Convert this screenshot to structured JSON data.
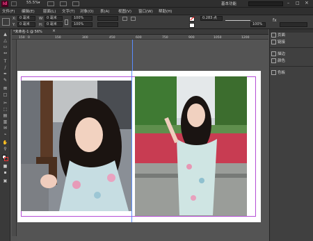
{
  "app": {
    "logo": "Id",
    "zoom": "55.5%",
    "workspace": "基本功能"
  },
  "menu": [
    "文件(F)",
    "编辑(E)",
    "版面(L)",
    "文字(T)",
    "对象(O)",
    "表(A)",
    "视图(V)",
    "窗口(W)",
    "帮助(H)"
  ],
  "control": {
    "x": "0 毫米",
    "y": "0 毫米",
    "w": "0 毫米",
    "h": "0 毫米",
    "stroke": "0.283 点",
    "pct": "100%"
  },
  "doc_tab": "*未命名-1 @ 56%",
  "ruler_ticks": [
    "150",
    "0",
    "150",
    "300",
    "450",
    "600",
    "750",
    "900",
    "1050",
    "1200"
  ],
  "panels": [
    {
      "icon": "pages-icon",
      "label": "页面"
    },
    {
      "icon": "links-icon",
      "label": "链接"
    },
    {
      "icon": "stroke-icon",
      "label": "描边"
    },
    {
      "icon": "color-icon",
      "label": "颜色"
    },
    {
      "icon": "swatches-icon",
      "label": "色板"
    }
  ],
  "colors": {
    "frame_guide": "#b44cd6",
    "column_guide": "#5a8cff",
    "page": "#ffffff"
  }
}
